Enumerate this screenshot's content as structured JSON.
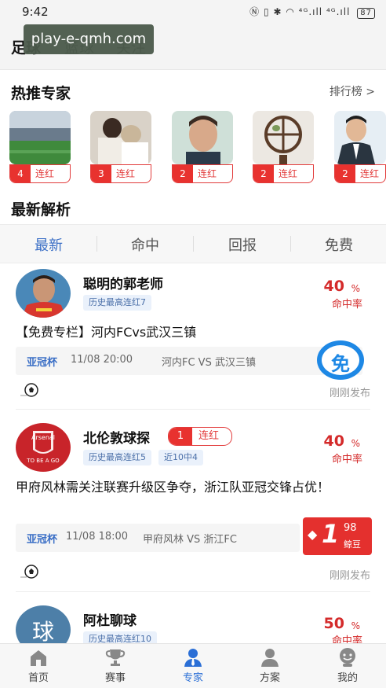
{
  "status": {
    "time": "9:42",
    "battery": "87",
    "signal": "⁴ᴳ.ıll ⁴ᴳ.ıll"
  },
  "watermark": "play-e-qmh.com",
  "top_tabs": [
    "足球",
    "篮球",
    "关注"
  ],
  "hot_experts": {
    "title": "热推专家",
    "rank_link": "排行榜 >",
    "items": [
      {
        "streak": "4",
        "label": "连红"
      },
      {
        "streak": "3",
        "label": "连红"
      },
      {
        "streak": "2",
        "label": "连红"
      },
      {
        "streak": "2",
        "label": "连红"
      },
      {
        "streak": "2",
        "label": "连红"
      }
    ]
  },
  "latest": {
    "title": "最新解析",
    "tabs": [
      "最新",
      "命中",
      "回报",
      "免费"
    ]
  },
  "cards": [
    {
      "name": "聪明的郭老师",
      "tags": [
        "历史最高连红7"
      ],
      "rate": "40",
      "pct": "%",
      "rate_label": "命中率",
      "title": "【免费专栏】河内FCvs武汉三镇",
      "league": "亚冠杯",
      "time": "11/08 20:00",
      "teams": "河内FC VS 武汉三镇",
      "free_badge": "免",
      "publish": "刚刚发布"
    },
    {
      "name": "北伦敦球探",
      "streak": "1",
      "streak_label": "连红",
      "avatar_text": "Arsenal",
      "avatar_sub": "TO BE A GO",
      "tags": [
        "历史最高连红5",
        "近10中4"
      ],
      "rate": "40",
      "pct": "%",
      "rate_label": "命中率",
      "title": "甲府风林需关注联赛升级区争夺，浙江队亚冠交锋占优！",
      "league": "亚冠杯",
      "time": "11/08 18:00",
      "teams": "甲府风林 VS 浙江FC",
      "price_digit": "1",
      "price_sup": "98",
      "price_unit": "鲸豆",
      "publish": "刚刚发布"
    },
    {
      "name": "阿杜聊球",
      "avatar_text": "球",
      "tags": [
        "历史最高连红10"
      ],
      "rate": "50",
      "pct": "%",
      "rate_label": "命中率"
    }
  ],
  "nav": [
    {
      "label": "首页",
      "icon": "home-icon"
    },
    {
      "label": "赛事",
      "icon": "trophy-icon"
    },
    {
      "label": "专家",
      "icon": "expert-icon",
      "active": true
    },
    {
      "label": "方案",
      "icon": "plan-icon"
    },
    {
      "label": "我的",
      "icon": "profile-icon"
    }
  ],
  "colors": {
    "accent": "#2b6fd6",
    "red": "#e8322f",
    "tag_bg": "#eaf1fb"
  }
}
